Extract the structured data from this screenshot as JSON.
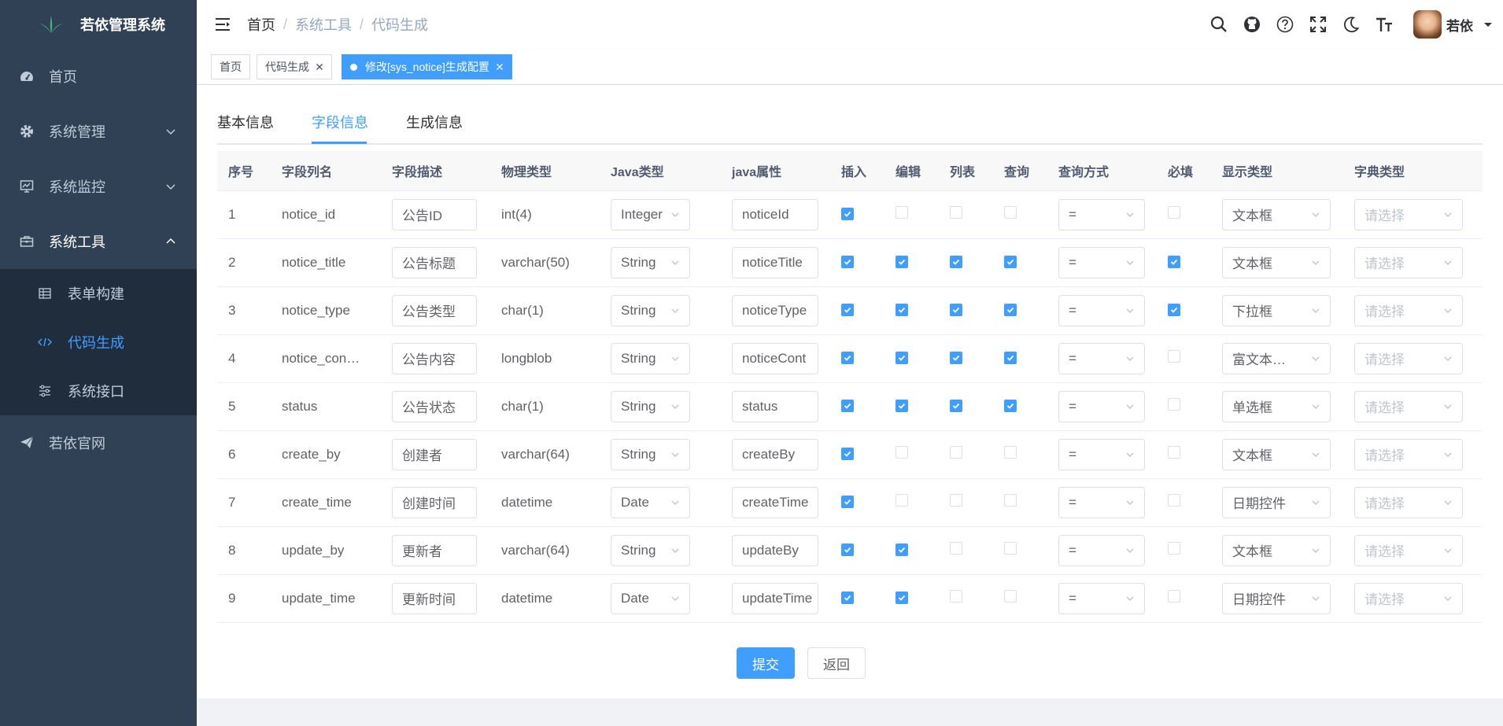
{
  "app": {
    "title": "若依管理系统"
  },
  "sidebar": {
    "items": [
      {
        "label": "首页",
        "icon": "dashboard-icon"
      },
      {
        "label": "系统管理",
        "icon": "gear-icon"
      },
      {
        "label": "系统监控",
        "icon": "monitor-icon"
      },
      {
        "label": "系统工具",
        "icon": "toolbox-icon"
      },
      {
        "label": "若依官网",
        "icon": "paper-plane-icon"
      }
    ],
    "submenu": [
      {
        "label": "表单构建",
        "icon": "table-icon"
      },
      {
        "label": "代码生成",
        "icon": "code-icon"
      },
      {
        "label": "系统接口",
        "icon": "sliders-icon"
      }
    ]
  },
  "breadcrumb": [
    "首页",
    "系统工具",
    "代码生成"
  ],
  "user": {
    "name": "若依"
  },
  "tags": [
    {
      "label": "首页"
    },
    {
      "label": "代码生成"
    },
    {
      "label": "修改[sys_notice]生成配置"
    }
  ],
  "tabs": [
    "基本信息",
    "字段信息",
    "生成信息"
  ],
  "table": {
    "headers": [
      "序号",
      "字段列名",
      "字段描述",
      "物理类型",
      "Java类型",
      "java属性",
      "插入",
      "编辑",
      "列表",
      "查询",
      "查询方式",
      "必填",
      "显示类型",
      "字典类型"
    ],
    "dict_placeholder": "请选择",
    "rows": [
      {
        "no": "1",
        "column": "notice_id",
        "desc": "公告ID",
        "ptype": "int(4)",
        "jtype": "Integer",
        "jattr": "noticeId",
        "insert": true,
        "edit": false,
        "list": false,
        "query": false,
        "qtype": "=",
        "required": false,
        "html": "文本框"
      },
      {
        "no": "2",
        "column": "notice_title",
        "desc": "公告标题",
        "ptype": "varchar(50)",
        "jtype": "String",
        "jattr": "noticeTitle",
        "insert": true,
        "edit": true,
        "list": true,
        "query": true,
        "qtype": "=",
        "required": true,
        "html": "文本框"
      },
      {
        "no": "3",
        "column": "notice_type",
        "desc": "公告类型",
        "ptype": "char(1)",
        "jtype": "String",
        "jattr": "noticeType",
        "insert": true,
        "edit": true,
        "list": true,
        "query": true,
        "qtype": "=",
        "required": true,
        "html": "下拉框"
      },
      {
        "no": "4",
        "column": "notice_con…",
        "desc": "公告内容",
        "ptype": "longblob",
        "jtype": "String",
        "jattr": "noticeCont",
        "insert": true,
        "edit": true,
        "list": true,
        "query": true,
        "qtype": "=",
        "required": false,
        "html": "富文本…"
      },
      {
        "no": "5",
        "column": "status",
        "desc": "公告状态",
        "ptype": "char(1)",
        "jtype": "String",
        "jattr": "status",
        "insert": true,
        "edit": true,
        "list": true,
        "query": true,
        "qtype": "=",
        "required": false,
        "html": "单选框"
      },
      {
        "no": "6",
        "column": "create_by",
        "desc": "创建者",
        "ptype": "varchar(64)",
        "jtype": "String",
        "jattr": "createBy",
        "insert": true,
        "edit": false,
        "list": false,
        "query": false,
        "qtype": "=",
        "required": false,
        "html": "文本框"
      },
      {
        "no": "7",
        "column": "create_time",
        "desc": "创建时间",
        "ptype": "datetime",
        "jtype": "Date",
        "jattr": "createTime",
        "insert": true,
        "edit": false,
        "list": false,
        "query": false,
        "qtype": "=",
        "required": false,
        "html": "日期控件"
      },
      {
        "no": "8",
        "column": "update_by",
        "desc": "更新者",
        "ptype": "varchar(64)",
        "jtype": "String",
        "jattr": "updateBy",
        "insert": true,
        "edit": true,
        "list": false,
        "query": false,
        "qtype": "=",
        "required": false,
        "html": "文本框"
      },
      {
        "no": "9",
        "column": "update_time",
        "desc": "更新时间",
        "ptype": "datetime",
        "jtype": "Date",
        "jattr": "updateTime",
        "insert": true,
        "edit": true,
        "list": false,
        "query": false,
        "qtype": "=",
        "required": false,
        "html": "日期控件"
      }
    ]
  },
  "buttons": {
    "submit": "提交",
    "back": "返回"
  }
}
